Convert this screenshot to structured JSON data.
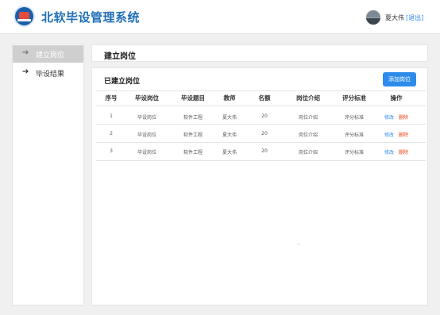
{
  "header": {
    "app_title": "北软毕设管理系统",
    "username": "夏大伟",
    "logout_label": "[退出]"
  },
  "sidebar": {
    "items": [
      {
        "label": "建立岗位",
        "active": true,
        "icon": "arrow-right-icon"
      },
      {
        "label": "毕设结果",
        "active": false,
        "icon": "arrow-right-icon"
      }
    ]
  },
  "page": {
    "title": "建立岗位",
    "section_title": "已建立岗位",
    "add_button_label": "添加岗位"
  },
  "table": {
    "headers": [
      "序号",
      "毕设岗位",
      "毕设题目",
      "教师",
      "名额",
      "岗位介绍",
      "评分标准",
      "操作"
    ],
    "rows": [
      {
        "index": "1",
        "position": "毕设岗位",
        "topic": "软件工程",
        "teacher": "夏大伟",
        "quota": "20",
        "intro": "岗位介绍",
        "criteria": "评分标准",
        "edit": "修改",
        "delete": "删除"
      },
      {
        "index": "2",
        "position": "毕设岗位",
        "topic": "软件工程",
        "teacher": "夏大伟",
        "quota": "20",
        "intro": "岗位介绍",
        "criteria": "评分标准",
        "edit": "修改",
        "delete": "删除"
      },
      {
        "index": "3",
        "position": "毕设岗位",
        "topic": "软件工程",
        "teacher": "夏大伟",
        "quota": "20",
        "intro": "岗位介绍",
        "criteria": "评分标准",
        "edit": "修改",
        "delete": "删除"
      }
    ]
  },
  "colors": {
    "brand": "#1f6fb8",
    "primary_button": "#2d8ceb",
    "link": "#2d8ceb",
    "danger": "#ed4014",
    "sidebar_active": "#cfcfcf"
  }
}
